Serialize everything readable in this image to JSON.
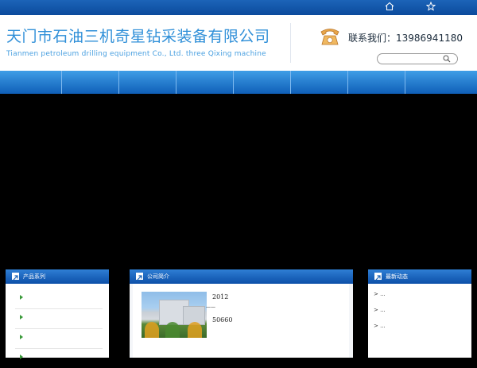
{
  "topbar": {
    "home_icon": "home-icon",
    "favorite_icon": "star-icon"
  },
  "header": {
    "title_cn": "天门市石油三机奇星钻采装备有限公司",
    "title_en": "Tianmen petroleum drilling equipment Co., Ltd. three Qixing machine",
    "contact_label": "联系我们：13986941180",
    "search_placeholder": ""
  },
  "nav": {
    "items": [
      "",
      "",
      "",
      "",
      "",
      "",
      "",
      ""
    ]
  },
  "panels": {
    "products": {
      "title": "产品系列",
      "items": [
        "",
        "",
        "",
        ""
      ]
    },
    "about": {
      "title": "公司简介",
      "line1": "2012",
      "line2": "——",
      "line3": "50660"
    },
    "news": {
      "title": "最新动态",
      "items": [
        "> ...",
        "> ...",
        "> ..."
      ]
    }
  },
  "colors": {
    "brand_blue": "#0c4fa8",
    "nav_blue": "#2f8fd8",
    "title_blue": "#2f8fd8"
  }
}
